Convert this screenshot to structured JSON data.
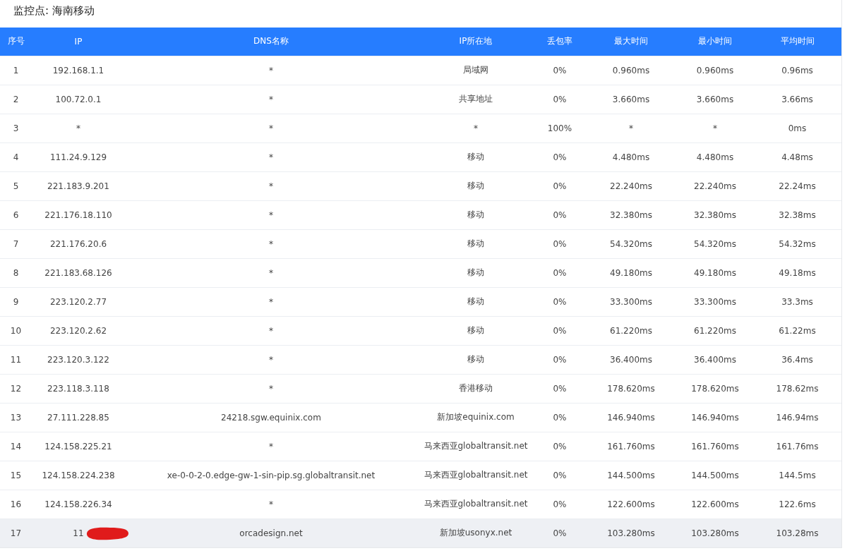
{
  "title": "监控点: 海南移动",
  "table": {
    "columns": [
      "序号",
      "IP",
      "DNS名称",
      "IP所在地",
      "丢包率",
      "最大时间",
      "最小时间",
      "平均时间"
    ],
    "rows": [
      {
        "cells": [
          "1",
          "192.168.1.1",
          "*",
          "局域网",
          "0%",
          "0.960ms",
          "0.960ms",
          "0.96ms"
        ],
        "selected": false,
        "redacted": false
      },
      {
        "cells": [
          "2",
          "100.72.0.1",
          "*",
          "共享地址",
          "0%",
          "3.660ms",
          "3.660ms",
          "3.66ms"
        ],
        "selected": false,
        "redacted": false
      },
      {
        "cells": [
          "3",
          "*",
          "*",
          "*",
          "100%",
          "*",
          "*",
          "0ms"
        ],
        "selected": false,
        "redacted": false
      },
      {
        "cells": [
          "4",
          "111.24.9.129",
          "*",
          "移动",
          "0%",
          "4.480ms",
          "4.480ms",
          "4.48ms"
        ],
        "selected": false,
        "redacted": false
      },
      {
        "cells": [
          "5",
          "221.183.9.201",
          "*",
          "移动",
          "0%",
          "22.240ms",
          "22.240ms",
          "22.24ms"
        ],
        "selected": false,
        "redacted": false
      },
      {
        "cells": [
          "6",
          "221.176.18.110",
          "*",
          "移动",
          "0%",
          "32.380ms",
          "32.380ms",
          "32.38ms"
        ],
        "selected": false,
        "redacted": false
      },
      {
        "cells": [
          "7",
          "221.176.20.6",
          "*",
          "移动",
          "0%",
          "54.320ms",
          "54.320ms",
          "54.32ms"
        ],
        "selected": false,
        "redacted": false
      },
      {
        "cells": [
          "8",
          "221.183.68.126",
          "*",
          "移动",
          "0%",
          "49.180ms",
          "49.180ms",
          "49.18ms"
        ],
        "selected": false,
        "redacted": false
      },
      {
        "cells": [
          "9",
          "223.120.2.77",
          "*",
          "移动",
          "0%",
          "33.300ms",
          "33.300ms",
          "33.3ms"
        ],
        "selected": false,
        "redacted": false
      },
      {
        "cells": [
          "10",
          "223.120.2.62",
          "*",
          "移动",
          "0%",
          "61.220ms",
          "61.220ms",
          "61.22ms"
        ],
        "selected": false,
        "redacted": false
      },
      {
        "cells": [
          "11",
          "223.120.3.122",
          "*",
          "移动",
          "0%",
          "36.400ms",
          "36.400ms",
          "36.4ms"
        ],
        "selected": false,
        "redacted": false
      },
      {
        "cells": [
          "12",
          "223.118.3.118",
          "*",
          "香港移动",
          "0%",
          "178.620ms",
          "178.620ms",
          "178.62ms"
        ],
        "selected": false,
        "redacted": false
      },
      {
        "cells": [
          "13",
          "27.111.228.85",
          "24218.sgw.equinix.com",
          "新加坡equinix.com",
          "0%",
          "146.940ms",
          "146.940ms",
          "146.94ms"
        ],
        "selected": false,
        "redacted": false
      },
      {
        "cells": [
          "14",
          "124.158.225.21",
          "*",
          "马来西亚globaltransit.net",
          "0%",
          "161.760ms",
          "161.760ms",
          "161.76ms"
        ],
        "selected": false,
        "redacted": false
      },
      {
        "cells": [
          "15",
          "124.158.224.238",
          "xe-0-0-2-0.edge-gw-1-sin-pip.sg.globaltransit.net",
          "马来西亚globaltransit.net",
          "0%",
          "144.500ms",
          "144.500ms",
          "144.5ms"
        ],
        "selected": false,
        "redacted": false
      },
      {
        "cells": [
          "16",
          "124.158.226.34",
          "*",
          "马来西亚globaltransit.net",
          "0%",
          "122.600ms",
          "122.600ms",
          "122.6ms"
        ],
        "selected": false,
        "redacted": false
      },
      {
        "cells": [
          "17",
          "11",
          "orcadesign.net",
          "新加坡usonyx.net",
          "0%",
          "103.280ms",
          "103.280ms",
          "103.28ms"
        ],
        "selected": true,
        "redacted": true
      }
    ]
  }
}
